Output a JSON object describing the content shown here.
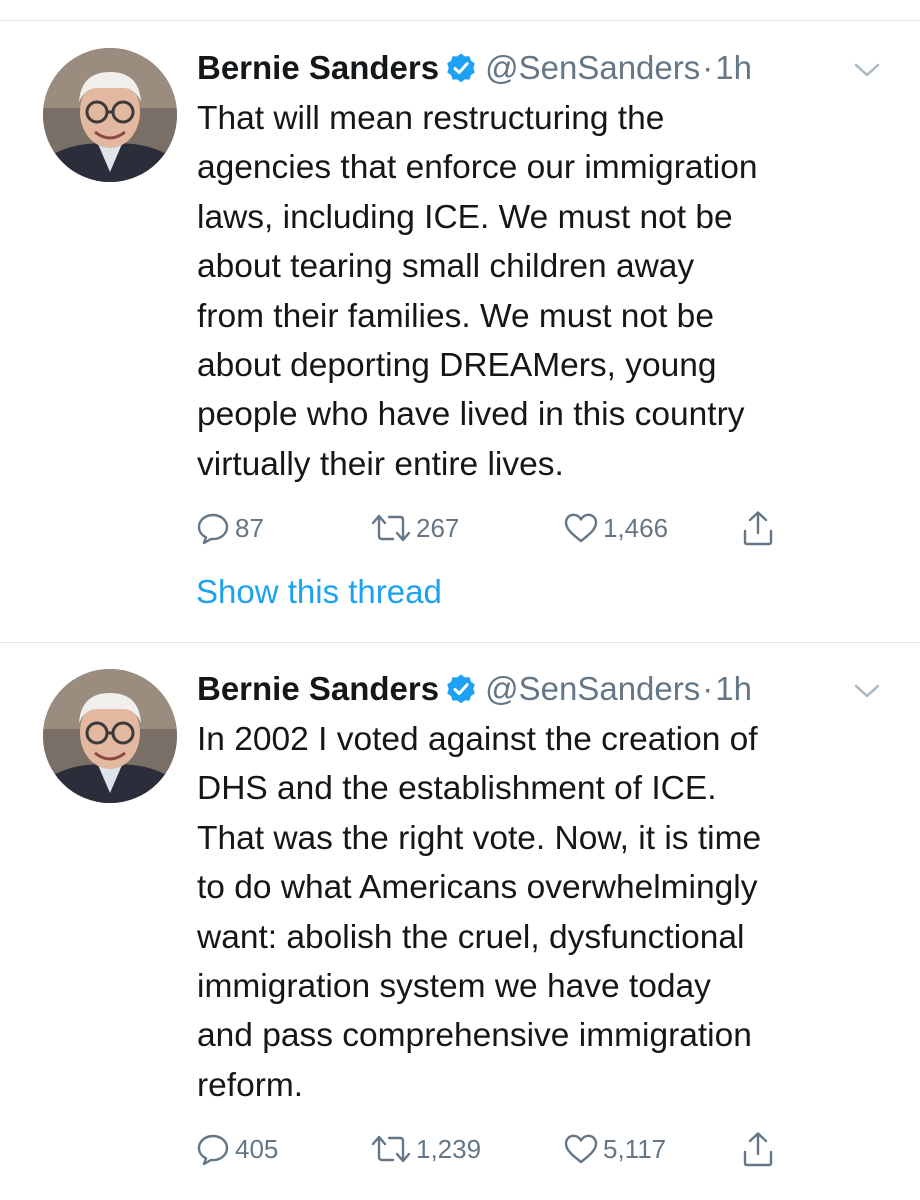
{
  "tweets": [
    {
      "author_name": "Bernie Sanders",
      "handle": "@SenSanders",
      "separator": "·",
      "time": "1h",
      "text_lines": [
        "That will mean restructuring the",
        "agencies that enforce our immigration",
        "laws, including ICE. We must not be",
        "about tearing small children away",
        "from their families. We must not be",
        "about deporting DREAMers, young",
        "people who have lived in this country",
        "virtually their entire lives."
      ],
      "replies": "87",
      "retweets": "267",
      "likes": "1,466",
      "thread_link": "Show this thread"
    },
    {
      "author_name": "Bernie Sanders",
      "handle": "@SenSanders",
      "separator": "·",
      "time": "1h",
      "text_lines": [
        "In 2002 I voted against the creation of",
        "DHS and the establishment of ICE.",
        "That was the right vote. Now, it is time",
        "to do what Americans overwhelmingly",
        "want: abolish the cruel, dysfunctional",
        "immigration system we have today",
        "and pass comprehensive immigration",
        "reform."
      ],
      "replies": "405",
      "retweets": "1,239",
      "likes": "5,117"
    }
  ],
  "icons": {
    "verified": "verified-badge-icon",
    "caret": "chevron-down-icon",
    "reply": "reply-icon",
    "retweet": "retweet-icon",
    "like": "heart-icon",
    "share": "share-icon"
  },
  "colors": {
    "text": "#14171a",
    "secondary": "#657786",
    "accent": "#1da1f2",
    "divider": "#e1e8ed"
  }
}
